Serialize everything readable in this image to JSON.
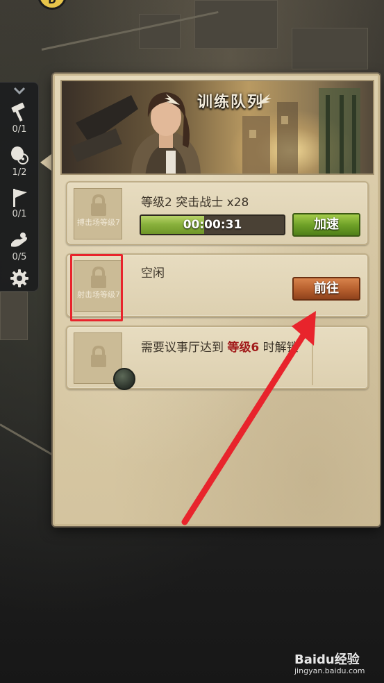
{
  "banner": {
    "title": "训练队列"
  },
  "sidebar": {
    "items": [
      {
        "icon": "hammer-icon",
        "count": "0/1"
      },
      {
        "icon": "research-icon",
        "count": "1/2"
      },
      {
        "icon": "flag-icon",
        "count": "0/1"
      },
      {
        "icon": "hand-icon",
        "count": "0/5"
      }
    ]
  },
  "queues": [
    {
      "slot_label": "搏击场等级7",
      "title": "等级2 突击战士 x28",
      "timer": "00:00:31",
      "progress": 0.44,
      "button": "加速"
    },
    {
      "slot_label": "射击场等级7",
      "title": "空闲",
      "button": "前往"
    },
    {
      "text_before": "需要议事厅达到 ",
      "text_level": "等级6",
      "text_after": " 时解锁"
    }
  ],
  "watermark": {
    "brand": "Baidu经验",
    "url": "jingyan.baidu.com"
  },
  "colors": {
    "accent_red": "#e8242c",
    "green_button": "#6fa128",
    "orange_button": "#b55e2d"
  }
}
